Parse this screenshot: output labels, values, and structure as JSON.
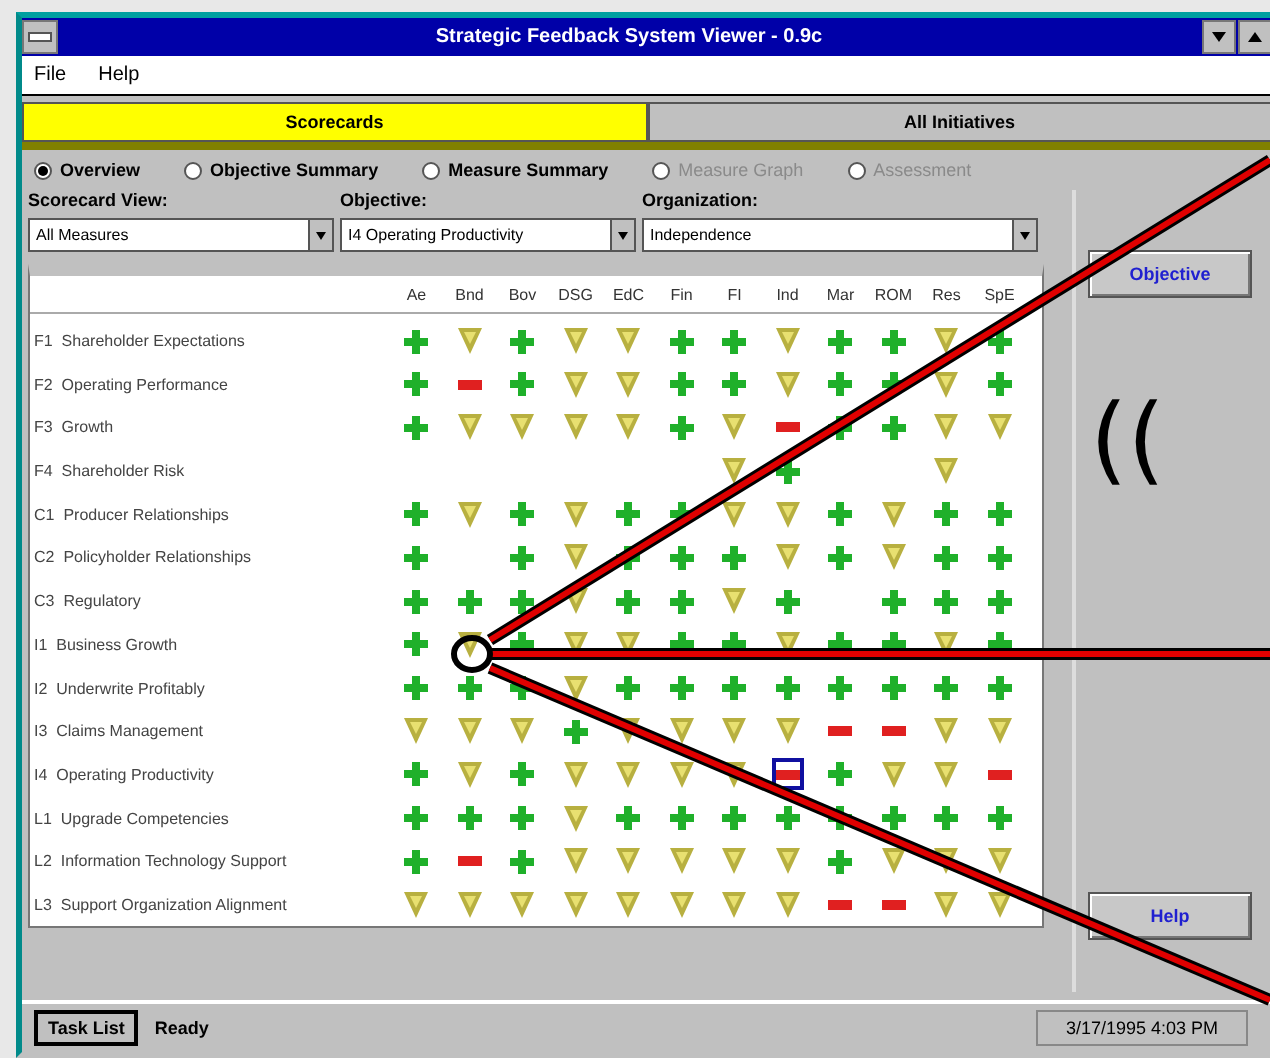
{
  "window": {
    "title": "Strategic Feedback System Viewer - 0.9c"
  },
  "menu": [
    "File",
    "Help"
  ],
  "tabs": [
    {
      "label": "Scorecards",
      "selected": true
    },
    {
      "label": "All Initiatives",
      "selected": false
    }
  ],
  "views": [
    {
      "label": "Overview",
      "selected": true,
      "disabled": false
    },
    {
      "label": "Objective Summary",
      "selected": false,
      "disabled": false
    },
    {
      "label": "Measure Summary",
      "selected": false,
      "disabled": false
    },
    {
      "label": "Measure Graph",
      "selected": false,
      "disabled": true
    },
    {
      "label": "Assessment",
      "selected": false,
      "disabled": true
    }
  ],
  "filters": [
    {
      "label": "Scorecard View:",
      "value": "All Measures"
    },
    {
      "label": "Objective:",
      "value": "I4 Operating Productivity"
    },
    {
      "label": "Organization:",
      "value": "Independence"
    }
  ],
  "grid": {
    "columns": [
      "Ae",
      "Bnd",
      "Bov",
      "DSG",
      "EdC",
      "Fin",
      "FI",
      "Ind",
      "Mar",
      "ROM",
      "Res",
      "SpE"
    ],
    "rows": [
      {
        "code": "F1",
        "name": "Shareholder Expectations",
        "cells": [
          {
            "kind": "up",
            "selected": false
          },
          {
            "kind": "down",
            "selected": false
          },
          {
            "kind": "up",
            "selected": false
          },
          {
            "kind": "down",
            "selected": false
          },
          {
            "kind": "down",
            "selected": false
          },
          {
            "kind": "up",
            "selected": false
          },
          {
            "kind": "up",
            "selected": false
          },
          {
            "kind": "down",
            "selected": false
          },
          {
            "kind": "up",
            "selected": false
          },
          {
            "kind": "up",
            "selected": false
          },
          {
            "kind": "down",
            "selected": false
          },
          {
            "kind": "up",
            "selected": false
          }
        ]
      },
      {
        "code": "F2",
        "name": "Operating Performance",
        "cells": [
          {
            "kind": "up",
            "selected": false
          },
          {
            "kind": "flat",
            "selected": false
          },
          {
            "kind": "up",
            "selected": false
          },
          {
            "kind": "down",
            "selected": false
          },
          {
            "kind": "down",
            "selected": false
          },
          {
            "kind": "up",
            "selected": false
          },
          {
            "kind": "up",
            "selected": false
          },
          {
            "kind": "down",
            "selected": false
          },
          {
            "kind": "up",
            "selected": false
          },
          {
            "kind": "up",
            "selected": false
          },
          {
            "kind": "down",
            "selected": false
          },
          {
            "kind": "up",
            "selected": false
          }
        ]
      },
      {
        "code": "F3",
        "name": "Growth",
        "cells": [
          {
            "kind": "up",
            "selected": false
          },
          {
            "kind": "down",
            "selected": false
          },
          {
            "kind": "down",
            "selected": false
          },
          {
            "kind": "down",
            "selected": false
          },
          {
            "kind": "down",
            "selected": false
          },
          {
            "kind": "up",
            "selected": false
          },
          {
            "kind": "down",
            "selected": false
          },
          {
            "kind": "flat",
            "selected": false
          },
          {
            "kind": "up",
            "selected": false
          },
          {
            "kind": "up",
            "selected": false
          },
          {
            "kind": "down",
            "selected": false
          },
          {
            "kind": "down",
            "selected": false
          }
        ]
      },
      {
        "code": "F4",
        "name": "Shareholder Risk",
        "cells": [
          {
            "kind": "none"
          },
          {
            "kind": "none"
          },
          {
            "kind": "none"
          },
          {
            "kind": "none"
          },
          {
            "kind": "none"
          },
          {
            "kind": "none"
          },
          {
            "kind": "down",
            "selected": false
          },
          {
            "kind": "up",
            "selected": false
          },
          {
            "kind": "none"
          },
          {
            "kind": "none"
          },
          {
            "kind": "down",
            "selected": false
          },
          {
            "kind": "none"
          }
        ]
      },
      {
        "code": "C1",
        "name": "Producer Relationships",
        "cells": [
          {
            "kind": "up",
            "selected": false
          },
          {
            "kind": "down",
            "selected": false
          },
          {
            "kind": "up",
            "selected": false
          },
          {
            "kind": "down",
            "selected": false
          },
          {
            "kind": "up",
            "selected": false
          },
          {
            "kind": "up",
            "selected": false
          },
          {
            "kind": "down",
            "selected": false
          },
          {
            "kind": "down",
            "selected": false
          },
          {
            "kind": "up",
            "selected": false
          },
          {
            "kind": "down",
            "selected": false
          },
          {
            "kind": "up",
            "selected": false
          },
          {
            "kind": "up",
            "selected": false
          }
        ]
      },
      {
        "code": "C2",
        "name": "Policyholder Relationships",
        "cells": [
          {
            "kind": "up",
            "selected": false
          },
          {
            "kind": "none"
          },
          {
            "kind": "up",
            "selected": false
          },
          {
            "kind": "down",
            "selected": false
          },
          {
            "kind": "up",
            "selected": false
          },
          {
            "kind": "up",
            "selected": false
          },
          {
            "kind": "up",
            "selected": false
          },
          {
            "kind": "down",
            "selected": false
          },
          {
            "kind": "up",
            "selected": false
          },
          {
            "kind": "down",
            "selected": false
          },
          {
            "kind": "up",
            "selected": false
          },
          {
            "kind": "up",
            "selected": false
          }
        ]
      },
      {
        "code": "C3",
        "name": "Regulatory",
        "cells": [
          {
            "kind": "up",
            "selected": false
          },
          {
            "kind": "up",
            "selected": false
          },
          {
            "kind": "up",
            "selected": false
          },
          {
            "kind": "down",
            "selected": false
          },
          {
            "kind": "up",
            "selected": false
          },
          {
            "kind": "up",
            "selected": false
          },
          {
            "kind": "down",
            "selected": false
          },
          {
            "kind": "up",
            "selected": false
          },
          {
            "kind": "none"
          },
          {
            "kind": "up",
            "selected": false
          },
          {
            "kind": "up",
            "selected": false
          },
          {
            "kind": "up",
            "selected": false
          }
        ]
      },
      {
        "code": "I1",
        "name": "Business Growth",
        "cells": [
          {
            "kind": "up",
            "selected": false
          },
          {
            "kind": "down",
            "selected": false
          },
          {
            "kind": "up",
            "selected": false
          },
          {
            "kind": "down",
            "selected": false
          },
          {
            "kind": "down",
            "selected": false
          },
          {
            "kind": "up",
            "selected": false
          },
          {
            "kind": "up",
            "selected": false
          },
          {
            "kind": "down",
            "selected": false
          },
          {
            "kind": "up",
            "selected": false
          },
          {
            "kind": "up",
            "selected": false
          },
          {
            "kind": "down",
            "selected": false
          },
          {
            "kind": "up",
            "selected": false
          }
        ]
      },
      {
        "code": "I2",
        "name": "Underwrite Profitably",
        "cells": [
          {
            "kind": "up",
            "selected": false
          },
          {
            "kind": "up",
            "selected": false
          },
          {
            "kind": "up",
            "selected": false
          },
          {
            "kind": "down",
            "selected": false
          },
          {
            "kind": "up",
            "selected": false
          },
          {
            "kind": "up",
            "selected": false
          },
          {
            "kind": "up",
            "selected": false
          },
          {
            "kind": "up",
            "selected": false
          },
          {
            "kind": "up",
            "selected": false
          },
          {
            "kind": "up",
            "selected": false
          },
          {
            "kind": "up",
            "selected": false
          },
          {
            "kind": "up",
            "selected": false
          }
        ]
      },
      {
        "code": "I3",
        "name": "Claims Management",
        "cells": [
          {
            "kind": "down",
            "selected": false
          },
          {
            "kind": "down",
            "selected": false
          },
          {
            "kind": "down",
            "selected": false
          },
          {
            "kind": "up",
            "selected": false
          },
          {
            "kind": "down",
            "selected": false
          },
          {
            "kind": "down",
            "selected": false
          },
          {
            "kind": "down",
            "selected": false
          },
          {
            "kind": "down",
            "selected": false
          },
          {
            "kind": "flat",
            "selected": false
          },
          {
            "kind": "flat",
            "selected": false
          },
          {
            "kind": "down",
            "selected": false
          },
          {
            "kind": "down",
            "selected": false
          }
        ]
      },
      {
        "code": "I4",
        "name": "Operating Productivity",
        "cells": [
          {
            "kind": "up",
            "selected": false
          },
          {
            "kind": "down",
            "selected": false
          },
          {
            "kind": "up",
            "selected": false
          },
          {
            "kind": "down",
            "selected": false
          },
          {
            "kind": "down",
            "selected": false
          },
          {
            "kind": "down",
            "selected": false
          },
          {
            "kind": "down",
            "selected": false
          },
          {
            "kind": "flat",
            "selected": true
          },
          {
            "kind": "up",
            "selected": false
          },
          {
            "kind": "down",
            "selected": false
          },
          {
            "kind": "down",
            "selected": false
          },
          {
            "kind": "flat",
            "selected": false
          }
        ]
      },
      {
        "code": "L1",
        "name": "Upgrade Competencies",
        "cells": [
          {
            "kind": "up",
            "selected": false
          },
          {
            "kind": "up",
            "selected": false
          },
          {
            "kind": "up",
            "selected": false
          },
          {
            "kind": "down",
            "selected": false
          },
          {
            "kind": "up",
            "selected": false
          },
          {
            "kind": "up",
            "selected": false
          },
          {
            "kind": "up",
            "selected": false
          },
          {
            "kind": "up",
            "selected": false
          },
          {
            "kind": "up",
            "selected": false
          },
          {
            "kind": "up",
            "selected": false
          },
          {
            "kind": "up",
            "selected": false
          },
          {
            "kind": "up",
            "selected": false
          }
        ]
      },
      {
        "code": "L2",
        "name": "Information Technology Support",
        "cells": [
          {
            "kind": "up",
            "selected": false
          },
          {
            "kind": "flat",
            "selected": false
          },
          {
            "kind": "up",
            "selected": false
          },
          {
            "kind": "down",
            "selected": false
          },
          {
            "kind": "down",
            "selected": false
          },
          {
            "kind": "down",
            "selected": false
          },
          {
            "kind": "down",
            "selected": false
          },
          {
            "kind": "down",
            "selected": false
          },
          {
            "kind": "up",
            "selected": false
          },
          {
            "kind": "down",
            "selected": false
          },
          {
            "kind": "down",
            "selected": false
          },
          {
            "kind": "down",
            "selected": false
          }
        ]
      },
      {
        "code": "L3",
        "name": "Support Organization Alignment",
        "cells": [
          {
            "kind": "down",
            "selected": false
          },
          {
            "kind": "down",
            "selected": false
          },
          {
            "kind": "down",
            "selected": false
          },
          {
            "kind": "down",
            "selected": false
          },
          {
            "kind": "down",
            "selected": false
          },
          {
            "kind": "down",
            "selected": false
          },
          {
            "kind": "down",
            "selected": false
          },
          {
            "kind": "down",
            "selected": false
          },
          {
            "kind": "flat",
            "selected": false
          },
          {
            "kind": "flat",
            "selected": false
          },
          {
            "kind": "down",
            "selected": false
          },
          {
            "kind": "down",
            "selected": false
          }
        ]
      }
    ]
  },
  "side_buttons": [
    "Objective",
    "Help"
  ],
  "annotation": {
    "text": "(("
  },
  "status_bar": {
    "button": "Task List",
    "message": "Ready",
    "datetime": "3/17/1995 4:03 PM"
  }
}
